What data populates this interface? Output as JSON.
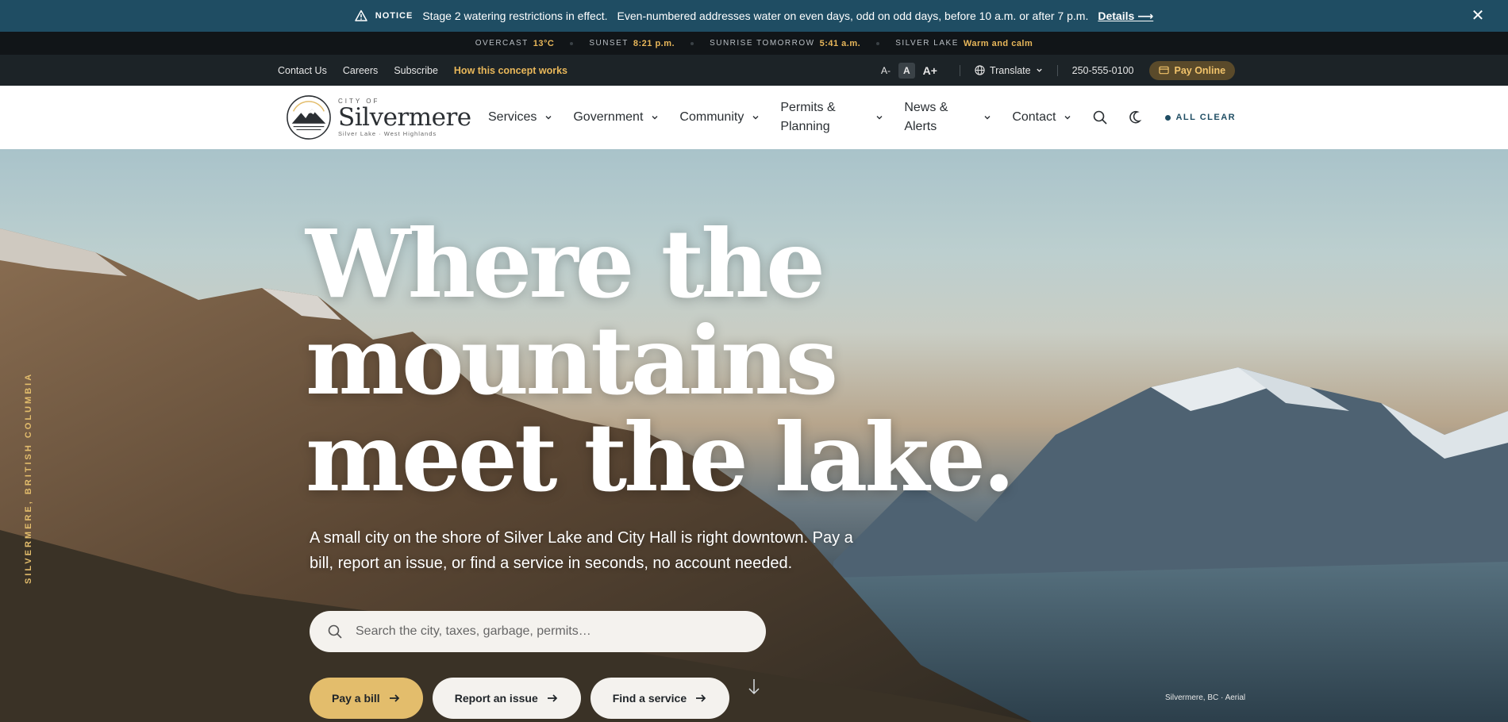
{
  "notice": {
    "tag": "NOTICE",
    "headline": "Stage 2 watering restrictions in effect.",
    "message": "Even-numbered addresses water on even days, odd on odd days, before 10 a.m. or after 7 p.m.",
    "details_label": "Details ⟶",
    "close_glyph": "✕"
  },
  "weather": [
    {
      "label": "OVERCAST",
      "value": "13°C"
    },
    {
      "label": "SUNSET",
      "value": "8:21 p.m."
    },
    {
      "label": "SUNRISE TOMORROW",
      "value": "5:41 a.m."
    },
    {
      "label": "SILVER LAKE",
      "value": "Warm and calm"
    }
  ],
  "utility": {
    "links": [
      "Contact Us",
      "Careers",
      "Subscribe"
    ],
    "accent_link": "How this concept works",
    "font_small": "A-",
    "font_default": "A",
    "font_large": "A+",
    "translate_label": "Translate",
    "phone": "250-555-0100",
    "pay_online_label": "Pay Online"
  },
  "brand": {
    "city_of": "CITY OF",
    "name": "Silvermere",
    "tagline": "Silver Lake · West Highlands"
  },
  "nav": {
    "items": [
      "Services",
      "Government",
      "Community"
    ],
    "permits": [
      "Permits &",
      "Planning"
    ],
    "news": [
      "News &",
      "Alerts"
    ],
    "contact": "Contact",
    "status_label": "ALL CLEAR"
  },
  "hero": {
    "title_lines": [
      "Where the",
      "mountains",
      "meet the lake."
    ],
    "subtitle": "A small city on the shore of Silver Lake and City Hall is right downtown. Pay a bill, report an issue, or find a service in seconds, no account needed.",
    "search_placeholder": "Search the city, taxes, garbage, permits…",
    "ctas": [
      "Pay a bill",
      "Report an issue",
      "Find a service"
    ],
    "vertical_label": "SILVERMERE, BRITISH COLUMBIA",
    "photo_credit": "Silvermere, BC · Aerial"
  },
  "colors": {
    "notice_bg": "#1f4d63",
    "accent_gold": "#e3bd6c",
    "dark_bar": "#1c2327"
  }
}
